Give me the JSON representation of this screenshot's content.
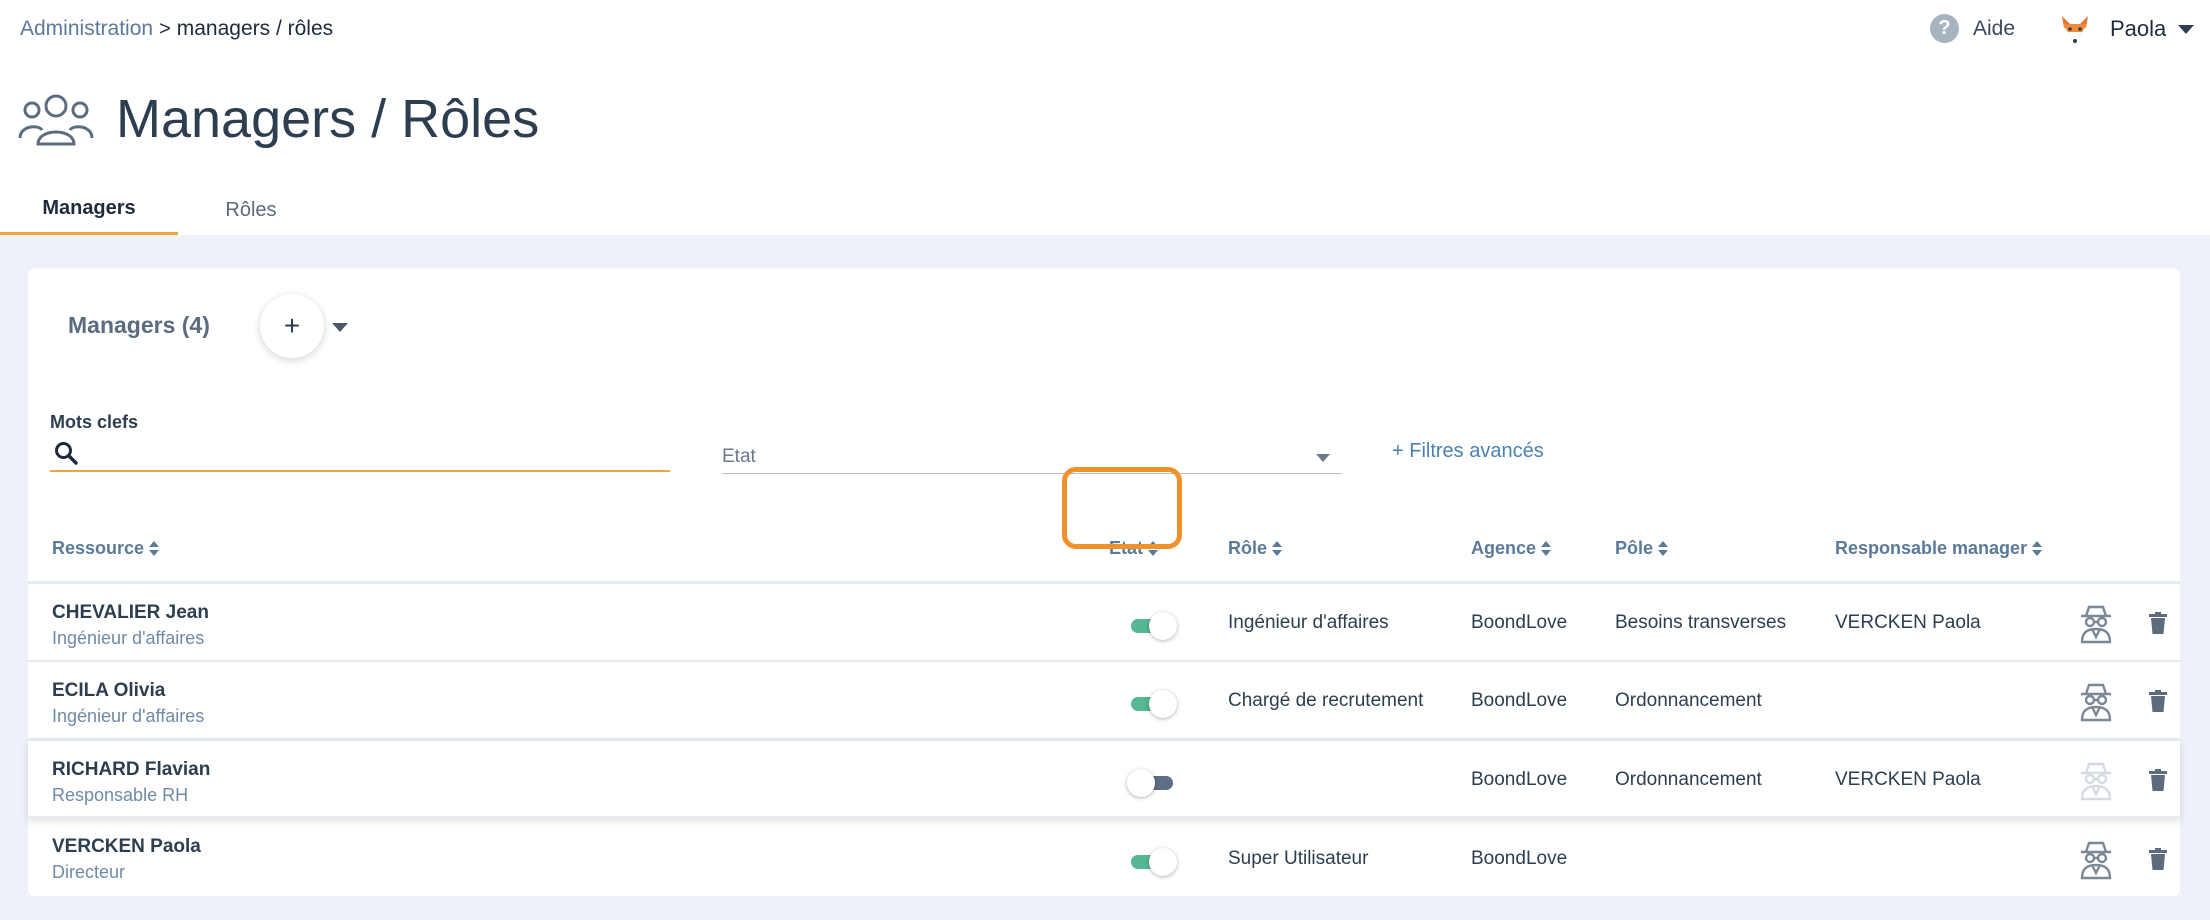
{
  "breadcrumb": {
    "root": "Administration",
    "separator": ">",
    "current": "managers / rôles"
  },
  "header": {
    "help_label": "Aide",
    "user_name": "Paola",
    "avatar_icon": "fox-avatar-icon"
  },
  "page": {
    "title": "Managers / Rôles",
    "icon": "users-group-icon"
  },
  "tabs": [
    {
      "label": "Managers",
      "active": true
    },
    {
      "label": "Rôles",
      "active": false
    }
  ],
  "card": {
    "title": "Managers (4)",
    "add_label": "+"
  },
  "filters": {
    "keywords_label": "Mots clefs",
    "keywords_value": "",
    "etat_placeholder": "Etat",
    "advanced_label": "+ Filtres avancés"
  },
  "columns": {
    "ressource": "Ressource",
    "etat": "Etat",
    "role": "Rôle",
    "agence": "Agence",
    "pole": "Pôle",
    "responsable": "Responsable manager"
  },
  "rows": [
    {
      "name": "CHEVALIER Jean",
      "subtitle": "Ingénieur d'affaires",
      "etat_on": true,
      "role": "Ingénieur d'affaires",
      "agence": "BoondLove",
      "pole": "Besoins transverses",
      "responsable": "VERCKEN Paola",
      "spy_active": true
    },
    {
      "name": "ECILA Olivia",
      "subtitle": "Ingénieur d'affaires",
      "etat_on": true,
      "role": "Chargé de recrutement",
      "agence": "BoondLove",
      "pole": "Ordonnancement",
      "responsable": "",
      "spy_active": true
    },
    {
      "name": "RICHARD Flavian",
      "subtitle": "Responsable RH",
      "etat_on": false,
      "role": "",
      "agence": "BoondLove",
      "pole": "Ordonnancement",
      "responsable": "VERCKEN Paola",
      "spy_active": false
    },
    {
      "name": "VERCKEN Paola",
      "subtitle": "Directeur",
      "etat_on": true,
      "role": "Super Utilisateur",
      "agence": "BoondLove",
      "pole": "",
      "responsable": "",
      "spy_active": true
    }
  ],
  "colors": {
    "accent": "#f0a53a",
    "toggle_on": "#55b892",
    "toggle_off": "#5d6e85",
    "focus_ring": "#f0922b"
  }
}
